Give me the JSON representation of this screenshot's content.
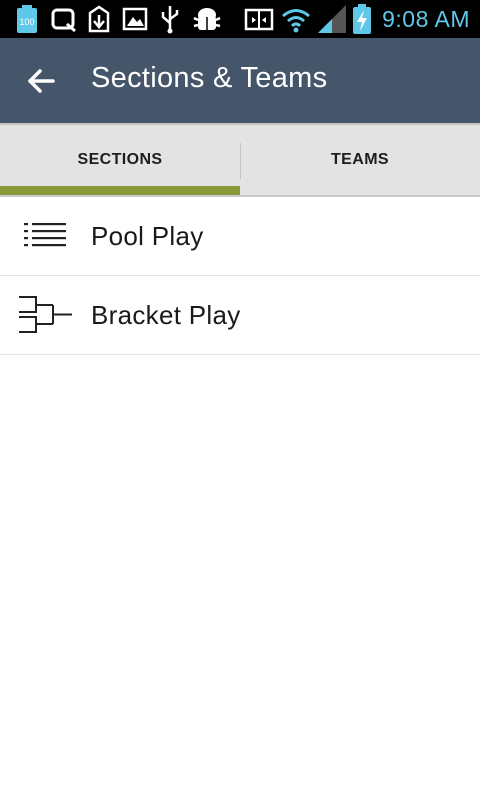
{
  "status_bar": {
    "battery_badge": "100",
    "time": "9:08 AM",
    "time_color": "#5fc8e8",
    "icons": [
      "battery-100-notification-icon",
      "q-app-icon",
      "download-icon",
      "image-icon",
      "usb-icon",
      "android-debug-icon",
      "screen-mirror-icon",
      "wifi-icon",
      "cell-signal-icon",
      "battery-charging-icon"
    ]
  },
  "app_bar": {
    "title": "Sections & Teams",
    "background_color": "#45556a",
    "back_icon": "arrow-left-icon"
  },
  "tabs": [
    {
      "label": "SECTIONS",
      "selected": true
    },
    {
      "label": "TEAMS",
      "selected": false
    }
  ],
  "tab_indicator_color": "#8a9a3a",
  "list": {
    "items": [
      {
        "label": "Pool Play",
        "icon": "list-icon"
      },
      {
        "label": "Bracket Play",
        "icon": "bracket-icon"
      }
    ]
  }
}
